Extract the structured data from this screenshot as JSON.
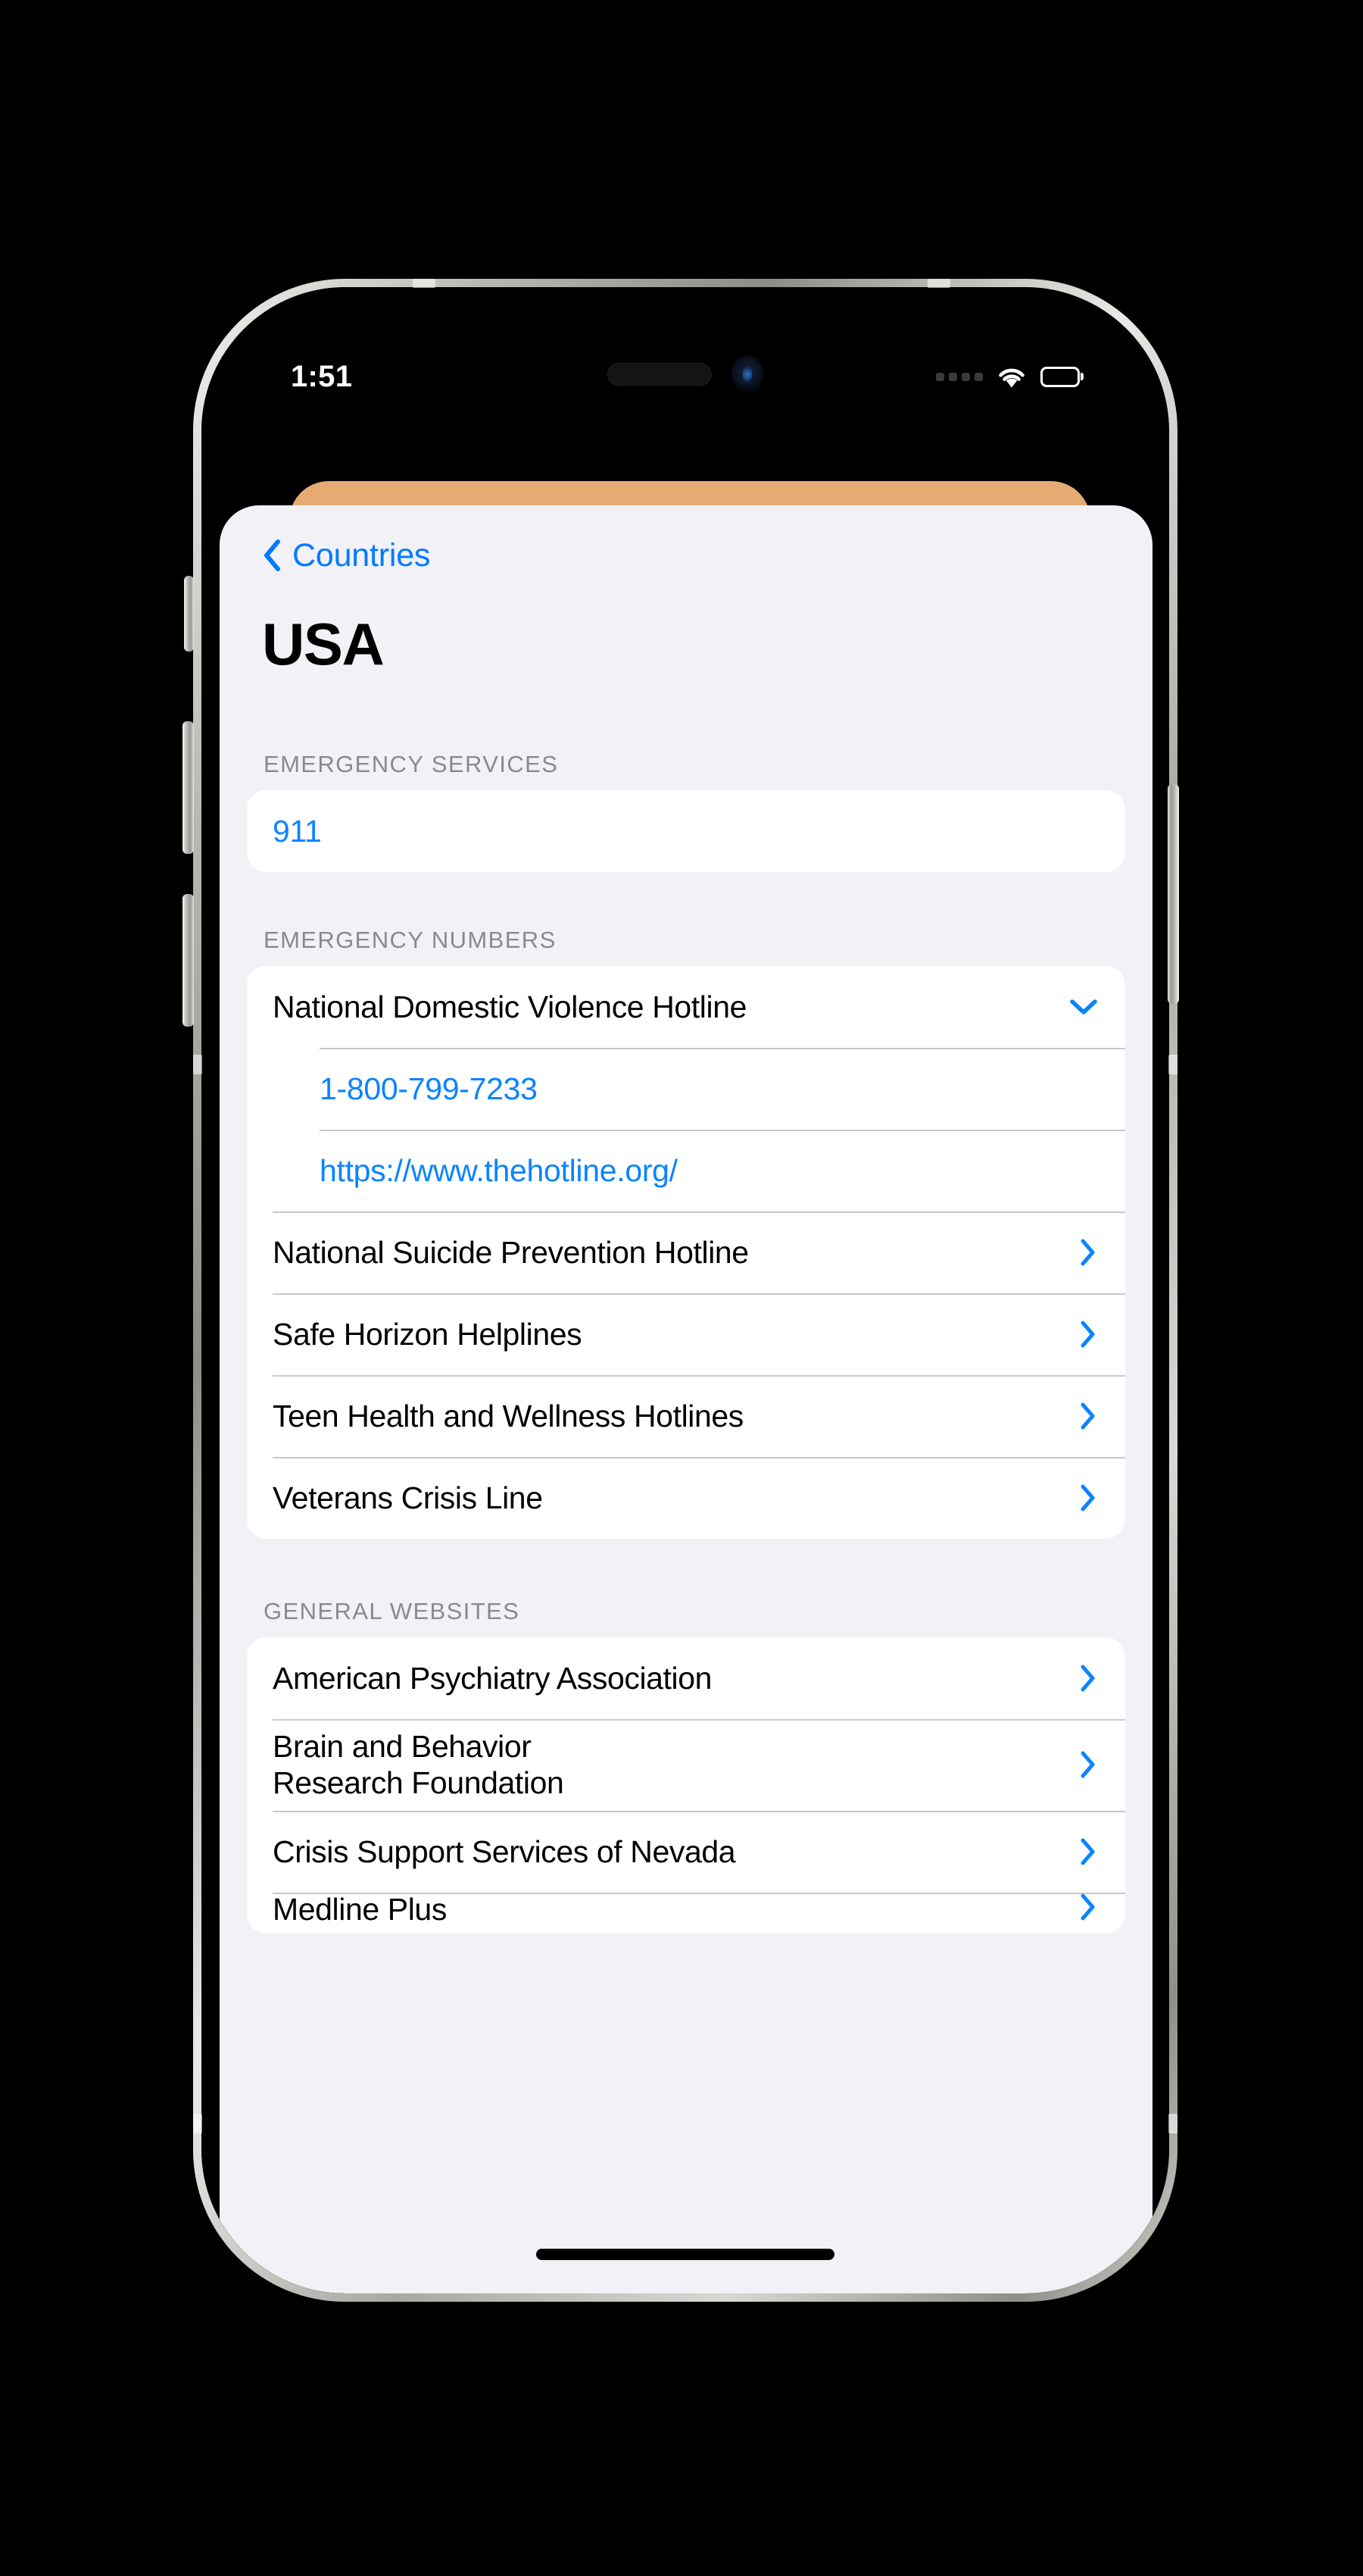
{
  "status_bar": {
    "time": "1:51",
    "signal_icon": "signal-dots-icon",
    "wifi_icon": "wifi-icon",
    "battery_icon": "battery-icon"
  },
  "nav": {
    "back_icon": "chevron-left-icon",
    "back_label": "Countries"
  },
  "page": {
    "title": "USA"
  },
  "colors": {
    "accent": "#007aff",
    "link": "#0a84ff",
    "background": "#f1f1f6",
    "card": "#ffffff",
    "header_text": "#8a8a8e",
    "card_behind": "#e5ab73"
  },
  "sections": [
    {
      "header": "EMERGENCY SERVICES",
      "rows": [
        {
          "label": "911",
          "type": "link"
        }
      ]
    },
    {
      "header": "EMERGENCY NUMBERS",
      "rows": [
        {
          "label": "National Domestic Violence Hotline",
          "type": "expanded",
          "icon": "chevron-down-icon"
        },
        {
          "label": "1-800-799-7233",
          "type": "detail-link"
        },
        {
          "label": "https://www.thehotline.org/",
          "type": "detail-link"
        },
        {
          "label": "National Suicide Prevention Hotline",
          "type": "disclosure",
          "icon": "chevron-right-icon"
        },
        {
          "label": "Safe Horizon Helplines",
          "type": "disclosure",
          "icon": "chevron-right-icon"
        },
        {
          "label": "Teen Health and Wellness Hotlines",
          "type": "disclosure",
          "icon": "chevron-right-icon"
        },
        {
          "label": "Veterans Crisis Line",
          "type": "disclosure",
          "icon": "chevron-right-icon"
        }
      ]
    },
    {
      "header": "GENERAL WEBSITES",
      "rows": [
        {
          "label": "American Psychiatry Association",
          "type": "disclosure",
          "icon": "chevron-right-icon"
        },
        {
          "label": "Brain and Behavior\nResearch Foundation",
          "type": "disclosure",
          "icon": "chevron-right-icon"
        },
        {
          "label": "Crisis Support Services of Nevada",
          "type": "disclosure",
          "icon": "chevron-right-icon"
        },
        {
          "label": "Medline Plus",
          "type": "disclosure-clipped",
          "icon": "chevron-right-icon"
        }
      ]
    }
  ]
}
